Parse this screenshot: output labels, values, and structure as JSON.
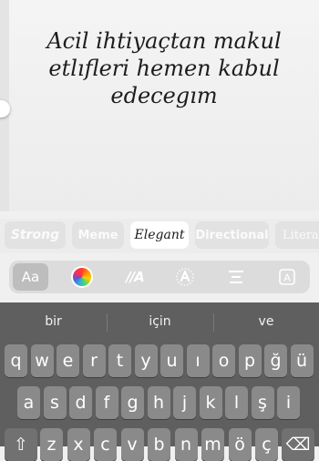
{
  "canvas": {
    "text": "Acil ihtiyaçtan makul etlıfleri hemen kabul edecegım"
  },
  "font_styles": [
    {
      "label": "Strong",
      "selected": false
    },
    {
      "label": "Meme",
      "selected": false
    },
    {
      "label": "Elegant",
      "selected": true
    },
    {
      "label": "Directional",
      "selected": false
    },
    {
      "label": "Literat",
      "selected": false
    }
  ],
  "toolbar": {
    "font_label": "Aa",
    "color_icon": "color-wheel-icon",
    "animation_label": "//A",
    "effect_icon": "sparkle-a-icon",
    "align_icon": "align-center-icon",
    "background_label": "A"
  },
  "keyboard": {
    "suggestions": [
      "bir",
      "için",
      "ve"
    ],
    "row1": [
      "q",
      "w",
      "e",
      "r",
      "t",
      "y",
      "u",
      "ı",
      "o",
      "p",
      "ğ",
      "ü"
    ],
    "row2": [
      "a",
      "s",
      "d",
      "f",
      "g",
      "h",
      "j",
      "k",
      "l",
      "ş",
      "i"
    ],
    "row3": [
      "shift-icon",
      "z",
      "x",
      "c",
      "v",
      "b",
      "n",
      "m",
      "ö",
      "ç",
      "backspace-icon"
    ]
  }
}
